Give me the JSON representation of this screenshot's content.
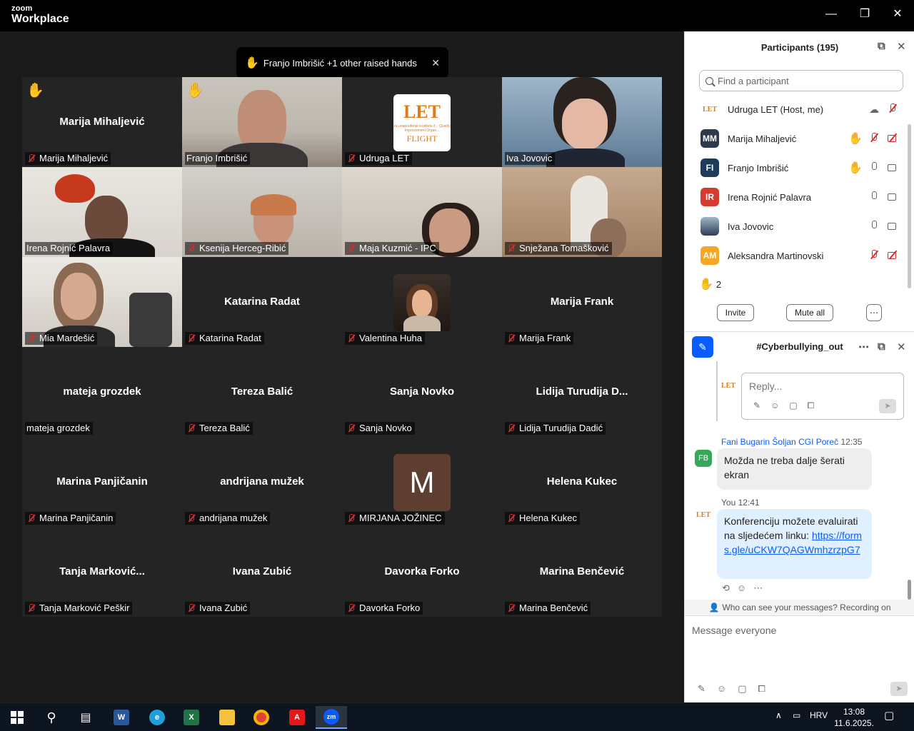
{
  "app": {
    "brand_small": "zoom",
    "brand_large": "Workplace"
  },
  "window_controls": {
    "minimize": "—",
    "restore": "❐",
    "close": "✕"
  },
  "banner": {
    "text": "Franjo Imbrišić +1 other raised hands"
  },
  "tiles": [
    {
      "big": "Marija Mihaljević",
      "label": "Marija Mihaljević"
    },
    {
      "label": "Franjo Imbrišić"
    },
    {
      "label": "Udruga LET"
    },
    {
      "label": "Iva Jovovic"
    },
    {
      "label": "Irena Rojnić Palavra"
    },
    {
      "label": "Ksenija Herceg-Ribić"
    },
    {
      "label": "Maja Kuzmić - IPC"
    },
    {
      "label": "Snježana Tomašković"
    },
    {
      "label": "Mia Mardešić"
    },
    {
      "big": "Katarina Radat",
      "label": "Katarina Radat"
    },
    {
      "label": "Valentina Huha"
    },
    {
      "big": "Marija Frank",
      "label": "Marija Frank"
    },
    {
      "big": "mateja grozdek",
      "label": "mateja grozdek"
    },
    {
      "big": "Tereza Balić",
      "label": "Tereza Balić"
    },
    {
      "big": "Sanja Novko",
      "label": "Sanja Novko"
    },
    {
      "big": "Lidija  Turudija  D...",
      "label": "Lidija Turudija Dadić"
    },
    {
      "big": "Marina Panjičanin",
      "label": "Marina Panjičanin"
    },
    {
      "big": "andrijana mužek",
      "label": "andrijana mužek"
    },
    {
      "label": "MIRJANA JOŽINEC",
      "avatar": "M"
    },
    {
      "big": "Helena Kukec",
      "label": "Helena Kukec"
    },
    {
      "big": "Tanja  Marković...",
      "label": "Tanja Marković Peškir"
    },
    {
      "big": "Ivana Zubić",
      "label": "Ivana Zubić"
    },
    {
      "big": "Davorka Forko",
      "label": "Davorka Forko"
    },
    {
      "big": "Marina Benčević",
      "label": "Marina Benčević"
    }
  ],
  "let_logo": {
    "main": "LET",
    "sub": "za unapređenje kvalitete ž... Quality Improvement Organ...",
    "flight": "FLIGHT"
  },
  "participants": {
    "title": "Participants (195)",
    "search_placeholder": "Find a participant",
    "rows": [
      {
        "name": "Udruga LET (Host, me)",
        "initials": "LET",
        "color": "#ffffff"
      },
      {
        "name": "Marija Mihaljević",
        "initials": "MM",
        "color": "#2d3a4a"
      },
      {
        "name": "Franjo Imbrišić",
        "initials": "FI",
        "color": "#1f3b5a"
      },
      {
        "name": "Irena Rojnić Palavra",
        "initials": "IR",
        "color": "#d63b2f"
      },
      {
        "name": "Iva Jovovic",
        "initials": "",
        "color": "#2f3f55"
      },
      {
        "name": "Aleksandra Martinovski",
        "initials": "AM",
        "color": "#f5a623"
      }
    ],
    "raised_count": "2",
    "invite": "Invite",
    "mute_all": "Mute all",
    "more": "⋯"
  },
  "chat": {
    "title": "#Cyberbullying_out",
    "reply_placeholder": "Reply...",
    "messages": [
      {
        "sender": "Fani Bugarin Šoljan CGI Poreč",
        "time": "12:35",
        "initials": "FB",
        "text": "Možda ne treba dalje šerati ekran"
      },
      {
        "sender": "You",
        "time": "12:41",
        "text": "Konferenciju možete evaluirati na sljedećem linku:",
        "link": "https://forms.gle/uCKW7QAGWmhzrzpG7"
      }
    ],
    "who_can_see": "Who can see your messages? Recording on",
    "compose_placeholder": "Message everyone"
  },
  "taskbar": {
    "lang": "HRV",
    "time": "13:08",
    "date": "11.6.2025."
  },
  "colors": {
    "accent": "#0b5cff",
    "active_speaker": "#23d959",
    "hand": "#f5b800",
    "mute": "#e02828"
  }
}
